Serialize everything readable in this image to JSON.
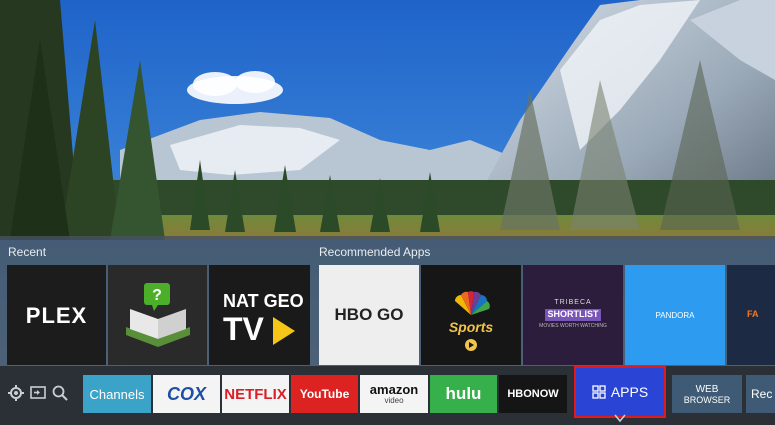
{
  "sections": {
    "recent_label": "Recent",
    "recommended_label": "Recommended Apps"
  },
  "recent": [
    {
      "name": "PLEX",
      "bg": "#1c1c1c"
    },
    {
      "name": "E-book",
      "bg": "#2a2a2a"
    },
    {
      "name": "NAT GEO TV",
      "line1": "NAT GEO",
      "line2": "TV",
      "bg": "#1a1a1a"
    }
  ],
  "recommended": [
    {
      "name": "HBO GO",
      "bg": "#eeeeee"
    },
    {
      "name": "NBC Sports",
      "text": "Sports",
      "bg": "#161616"
    },
    {
      "name": "Tribeca Shortlist",
      "top": "TRIBECA",
      "title": "SHORTLIST",
      "sub": "MOVIES WORTH WATCHING",
      "bg": "#2c1d3d"
    },
    {
      "name": "Pandora",
      "text": "PANDORA",
      "bg": "#2d9bf0"
    },
    {
      "name": "Fandango",
      "text": "FA",
      "bg": "#1c2a44"
    }
  ],
  "bottom": {
    "icons": [
      "settings-icon",
      "input-source-icon",
      "search-icon"
    ],
    "chips": [
      {
        "label": "Channels",
        "bg": "#3aa3c7",
        "fg": "#ffffff"
      },
      {
        "label": "COX",
        "bg": "#f4f4f4",
        "fg": "#1d4fa6"
      },
      {
        "label": "NETFLIX",
        "bg": "#f4f4f4",
        "fg": "#d81f26"
      },
      {
        "label": "YouTube",
        "bg": "#dd2222",
        "fg": "#ffffff"
      },
      {
        "label": "amazon",
        "sub": "video",
        "bg": "#f4f4f4",
        "fg": "#111111"
      },
      {
        "label": "hulu",
        "bg": "#36b04a",
        "fg": "#ffffff"
      },
      {
        "label": "HBONOW",
        "bg": "#151515",
        "fg": "#ffffff"
      }
    ],
    "apps_label": "APPS",
    "web_browser_line1": "WEB",
    "web_browser_line2": "BROWSER",
    "next_partial": "Rec"
  },
  "colors": {
    "panel": "#46525f",
    "bottom_bar": "#2b3036",
    "apps_focus": "#2a45d6",
    "focus_border": "#e01a1a",
    "natgeo_yellow": "#f5c518"
  }
}
